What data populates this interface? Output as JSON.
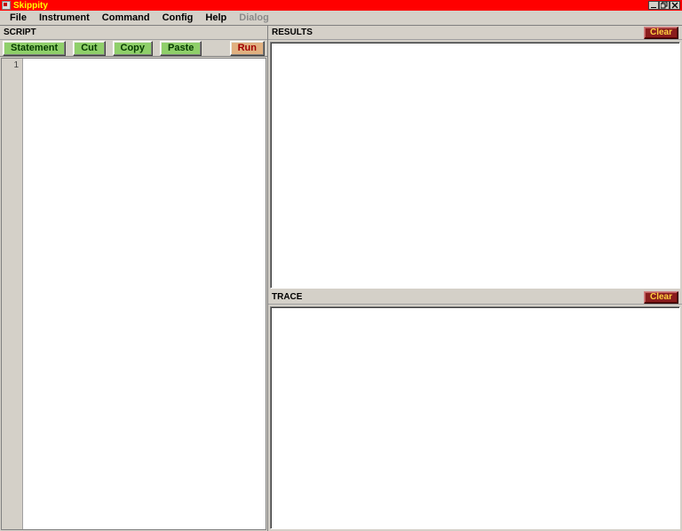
{
  "app": {
    "title": "Skippity"
  },
  "menu": {
    "file": "File",
    "instrument": "Instrument",
    "command": "Command",
    "config": "Config",
    "help": "Help",
    "dialog": "Dialog"
  },
  "panels": {
    "script": {
      "label": "SCRIPT"
    },
    "results": {
      "label": "RESULTS",
      "clear": "Clear"
    },
    "trace": {
      "label": "TRACE",
      "clear": "Clear"
    }
  },
  "toolbar": {
    "statement": "Statement",
    "cut": "Cut",
    "copy": "Copy",
    "paste": "Paste",
    "run": "Run"
  },
  "editor": {
    "line1": "1"
  }
}
